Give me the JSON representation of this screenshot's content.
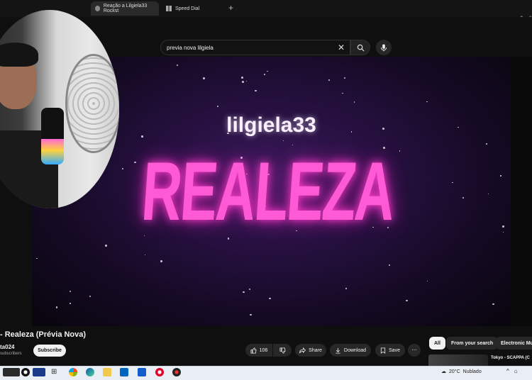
{
  "browser": {
    "tabs": [
      {
        "label": "Reação a Lilgiela33 Rockst"
      },
      {
        "label": "Speed Dial"
      }
    ],
    "new_tab_icon": "plus-icon"
  },
  "search": {
    "query": "previa nova lilgiela"
  },
  "video": {
    "artist_text": "lilgiela33",
    "song_text": "REALEZA",
    "title": "- Realeza (Prévia Nova)",
    "channel": "ta024",
    "subscribers": "subscribers",
    "subscribe_label": "Subscribe",
    "likes": "106",
    "share_label": "Share",
    "download_label": "Download",
    "save_label": "Save"
  },
  "chips": [
    {
      "label": "All"
    },
    {
      "label": "From your search"
    },
    {
      "label": "Electronic Mus"
    }
  ],
  "related": {
    "title": "Tokyo - SCAPPA (C"
  },
  "taskbar": {
    "weather_temp": "20°C",
    "weather_text": "Nublado"
  },
  "colors": {
    "accent_pink": "#ff5ad6",
    "background": "#0f0f0f"
  }
}
